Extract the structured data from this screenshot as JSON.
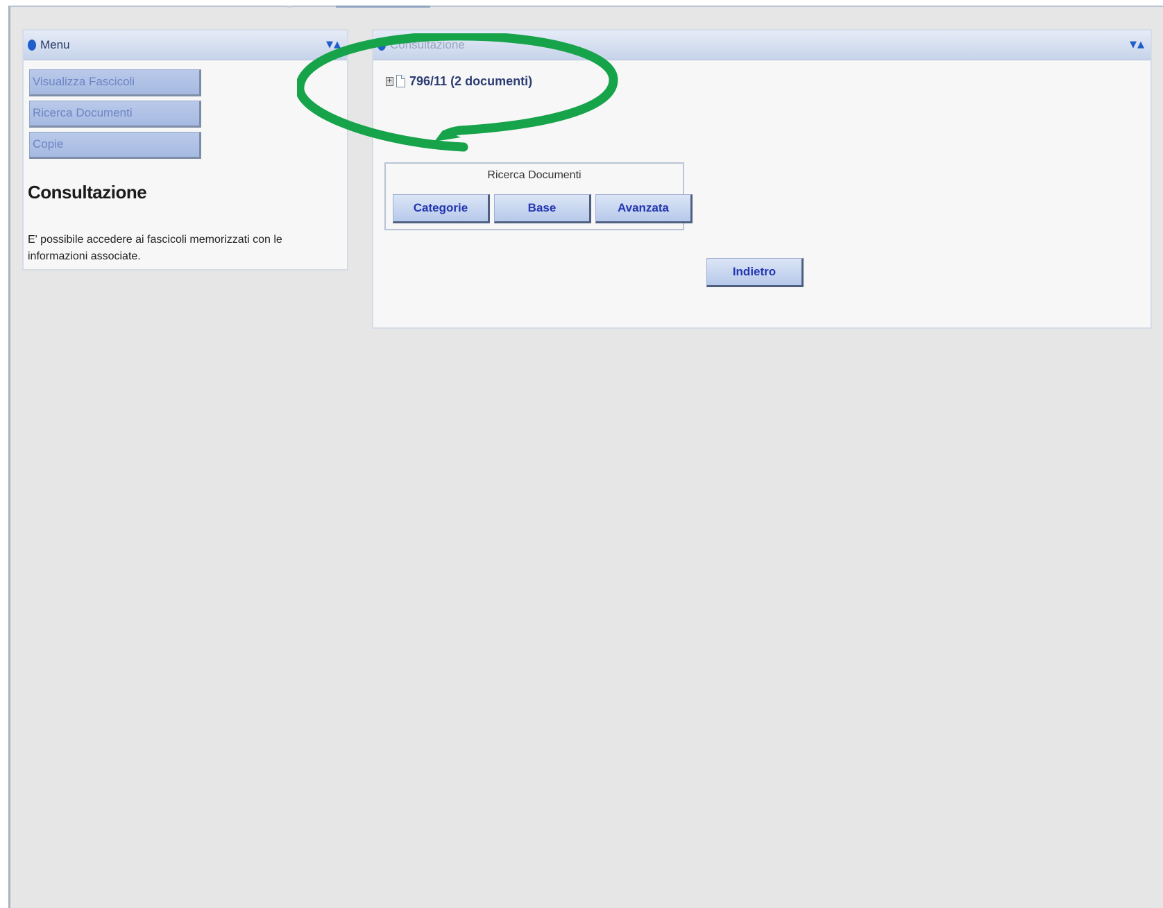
{
  "menu_portlet": {
    "title": "Menu",
    "arrows": "▼▲",
    "items": [
      {
        "label": "Visualizza Fascicoli"
      },
      {
        "label": "Ricerca Documenti"
      },
      {
        "label": "Copie"
      }
    ],
    "section_title": "Consultazione",
    "section_description": "E' possibile accedere ai fascicoli memorizzati con le informazioni associate."
  },
  "main_portlet": {
    "title": "Consultazione",
    "arrows": "▼▲",
    "tree": {
      "expand_glyph": "+",
      "node_label": "796/11 (2 documenti)"
    },
    "search_group": {
      "title": "Ricerca Documenti",
      "buttons": [
        {
          "label": "Categorie"
        },
        {
          "label": "Base"
        },
        {
          "label": "Avanzata"
        }
      ]
    },
    "back_button": "Indietro"
  },
  "colors": {
    "annotation": "#16a34a",
    "header_blue": "#c6d3ea",
    "button_text": "#2436b0"
  }
}
